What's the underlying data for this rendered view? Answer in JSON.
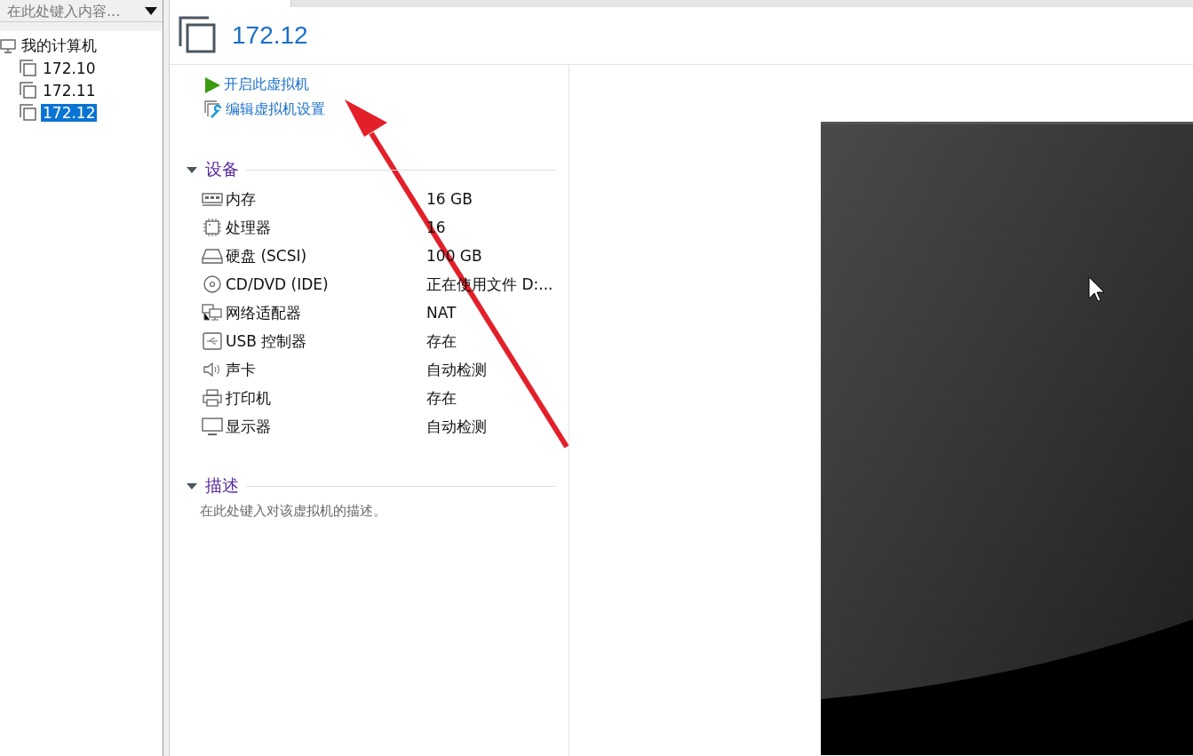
{
  "sidebar": {
    "search": {
      "placeholder": "在此处键入内容..."
    },
    "tree": [
      {
        "label": "我的计算机",
        "kind": "computer",
        "selected": false,
        "children": [
          {
            "label": "172.10",
            "kind": "vm",
            "selected": false
          },
          {
            "label": "172.11",
            "kind": "vm",
            "selected": false
          },
          {
            "label": "172.12",
            "kind": "vm",
            "selected": true
          }
        ]
      }
    ]
  },
  "header": {
    "title": "172.12"
  },
  "actions": [
    {
      "label": "开启此虚拟机",
      "kind": "power"
    },
    {
      "label": "编辑虚拟机设置",
      "kind": "settings"
    }
  ],
  "devices": {
    "title": "设备",
    "expanded": true,
    "items": [
      {
        "kind": "memory",
        "name": "内存",
        "value": "16 GB"
      },
      {
        "kind": "cpu",
        "name": "处理器",
        "value": "16"
      },
      {
        "kind": "disk",
        "name": "硬盘 (SCSI)",
        "value": "100 GB"
      },
      {
        "kind": "cd",
        "name": "CD/DVD (IDE)",
        "value": "正在使用文件 D:..."
      },
      {
        "kind": "network",
        "name": "网络适配器",
        "value": "NAT"
      },
      {
        "kind": "usb",
        "name": "USB 控制器",
        "value": "存在"
      },
      {
        "kind": "sound",
        "name": "声卡",
        "value": "自动检测"
      },
      {
        "kind": "printer",
        "name": "打印机",
        "value": "存在"
      },
      {
        "kind": "display",
        "name": "显示器",
        "value": "自动检测"
      }
    ]
  },
  "description": {
    "title": "描述",
    "expanded": true,
    "placeholder": "在此处键入对该虚拟机的描述。"
  }
}
